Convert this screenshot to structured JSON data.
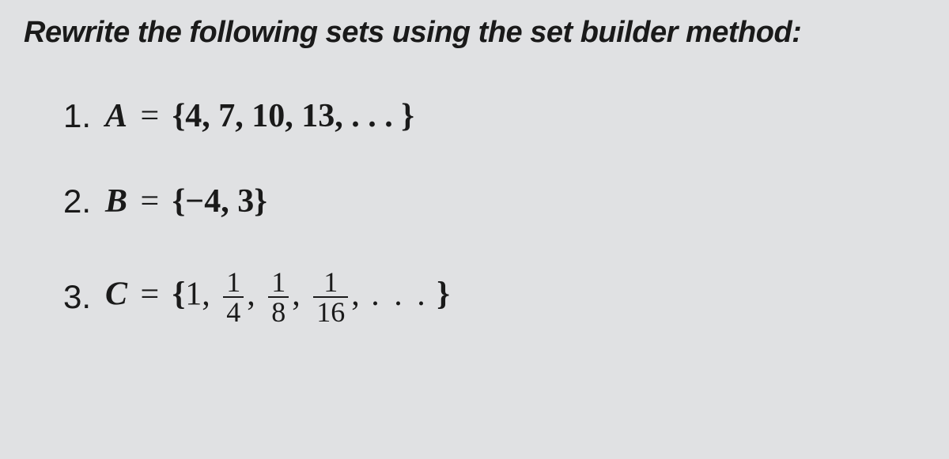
{
  "heading": "Rewrite the following sets using the set builder method:",
  "items": [
    {
      "number": "1.",
      "var": "A",
      "elements_text": "{4, 7, 10, 13, . . . }"
    },
    {
      "number": "2.",
      "var": "B",
      "elements_text": "{−4, 3}"
    },
    {
      "number": "3.",
      "var": "C",
      "first": "1",
      "fracs": [
        {
          "num": "1",
          "den": "4"
        },
        {
          "num": "1",
          "den": "8"
        },
        {
          "num": "1",
          "den": "16"
        }
      ],
      "dots": ". . .",
      "open": "{",
      "close": "}"
    }
  ],
  "eq_sign": "="
}
